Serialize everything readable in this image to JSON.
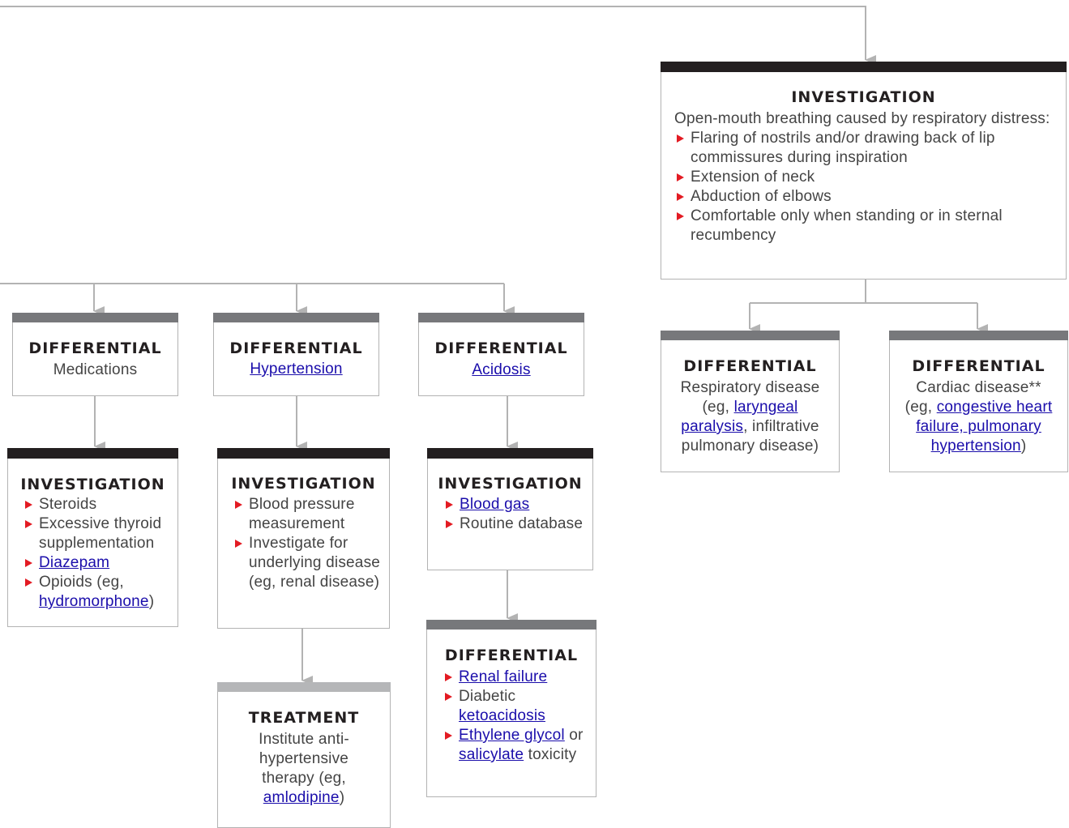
{
  "colors": {
    "investigation_bar": "#231f20",
    "differential_bar": "#77787b",
    "treatment_bar": "#b5b6b8",
    "connector": "#b3b3b3",
    "bullet": "#e31b23",
    "link": "#1a0dab"
  },
  "investigation_distress": {
    "heading": "INVESTIGATION",
    "intro": "Open-mouth breathing caused by respiratory distress:",
    "items": [
      "Flaring of nostrils and/or drawing back of lip commissures during inspiration",
      "Extension of neck",
      "Abduction of elbows",
      "Comfortable only when standing or in sternal recumbency"
    ]
  },
  "diff_respiratory": {
    "heading": "DIFFERENTIAL",
    "line1": "Respiratory disease",
    "pre": "(eg, ",
    "link": "laryngeal paralysis",
    "post": ", infiltrative pulmonary disease)"
  },
  "diff_cardiac": {
    "heading": "DIFFERENTIAL",
    "line1": "Cardiac disease**",
    "pre": "(eg, ",
    "link": "congestive heart failure, pulmonary hypertension",
    "post": ")"
  },
  "diff_medications": {
    "heading": "DIFFERENTIAL",
    "text": "Medications"
  },
  "diff_hypertension": {
    "heading": "DIFFERENTIAL",
    "link": "Hypertension"
  },
  "diff_acidosis": {
    "heading": "DIFFERENTIAL",
    "link": "Acidosis"
  },
  "inv_medications": {
    "heading": "INVESTIGATION",
    "item1": "Steroids",
    "item2": "Excessive thyroid supplementation",
    "item3_link": "Diazepam",
    "item4_pre": "Opioids (eg, ",
    "item4_link": "hydromorphone",
    "item4_post": ")"
  },
  "inv_hypertension": {
    "heading": "INVESTIGATION",
    "item1": "Blood pressure measurement",
    "item2": "Investigate for underlying disease (eg, renal disease)"
  },
  "inv_acidosis": {
    "heading": "INVESTIGATION",
    "item1_link": "Blood gas",
    "item2": "Routine database"
  },
  "treatment_hypertension": {
    "heading": "TREATMENT",
    "text": "Institute anti-hypertensive therapy (eg, ",
    "link": "amlodipine",
    "post": ")"
  },
  "diff_acidosis_causes": {
    "heading": "DIFFERENTIAL",
    "item1_link": "Renal failure",
    "item2_pre": "Diabetic ",
    "item2_link": "ketoacidosis",
    "item3_link": "Ethylene glycol",
    "item3_mid": " or ",
    "item3_link2": "salicylate",
    "item3_post": " toxicity"
  }
}
